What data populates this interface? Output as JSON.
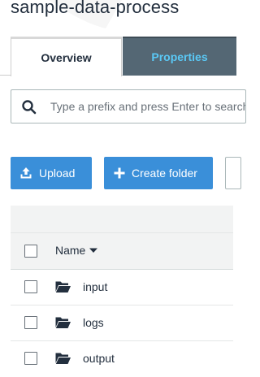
{
  "bucket": {
    "title": "sample-data-process"
  },
  "tabs": [
    {
      "label": "Overview",
      "active": true
    },
    {
      "label": "Properties",
      "active": false
    }
  ],
  "search": {
    "placeholder": "Type a prefix and press Enter to search"
  },
  "actions": {
    "upload_label": "Upload",
    "create_folder_label": "Create folder"
  },
  "table": {
    "name_header": "Name",
    "rows": [
      {
        "name": "input",
        "icon": "folder-icon"
      },
      {
        "name": "logs",
        "icon": "folder-icon"
      },
      {
        "name": "output",
        "icon": "folder-icon"
      }
    ]
  },
  "colors": {
    "button_blue": "#3a8fd9",
    "tab_inactive_bg": "#546774",
    "tab_inactive_text": "#5ac8f5"
  }
}
